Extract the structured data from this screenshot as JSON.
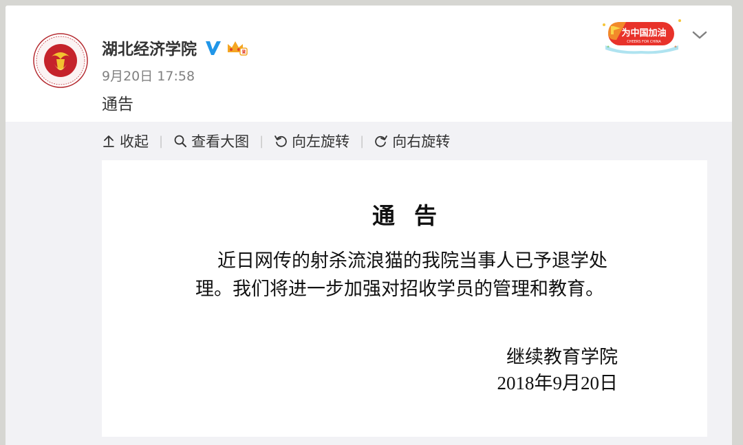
{
  "post": {
    "username": "湖北经济学院",
    "timestamp": "9月20日 17:58",
    "text": "通告"
  },
  "badge": {
    "text": "为中国加油",
    "subtext": "CHEERS FOR CHINA"
  },
  "toolbar": {
    "collapse_label": "收起",
    "view_large_label": "查看大图",
    "rotate_left_label": "向左旋转",
    "rotate_right_label": "向右旋转",
    "separator": "|"
  },
  "notice": {
    "title": "通告",
    "body": "近日网传的射杀流浪猫的我院当事人已予退学处理。我们将进一步加强对招收学员的管理和教育。",
    "org": "继续教育学院",
    "date": "2018年9月20日"
  },
  "colors": {
    "verify_blue": "#2196e8",
    "vip_orange": "#f4a623",
    "badge_red": "#e8322a"
  },
  "icons": {
    "verify": "verified-v-icon",
    "crown": "vip-crown-icon",
    "chevron": "chevron-down-icon",
    "collapse": "arrow-up-icon",
    "view": "magnifier-icon",
    "rotate_left": "rotate-left-icon",
    "rotate_right": "rotate-right-icon"
  }
}
